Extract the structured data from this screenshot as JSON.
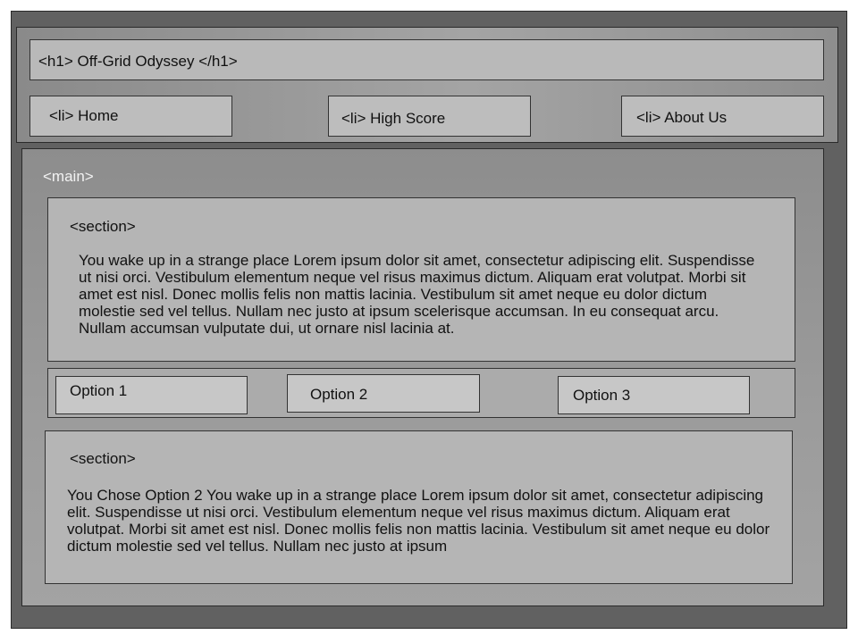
{
  "header": {
    "title": "<h1> Off-Grid Odyssey </h1>",
    "nav": [
      {
        "label": "<li> Home"
      },
      {
        "label": "<li> High Score"
      },
      {
        "label": "<li> About Us"
      }
    ]
  },
  "main": {
    "label": "<main>",
    "section1": {
      "label": "<section>",
      "text": "You wake up in a strange place Lorem ipsum dolor sit amet, consectetur adipiscing elit. Suspendisse ut nisi orci. Vestibulum elementum neque vel risus maximus dictum. Aliquam erat volutpat. Morbi sit amet est nisl. Donec mollis felis non mattis lacinia. Vestibulum sit amet neque eu dolor dictum molestie sed vel tellus. Nullam nec justo at ipsum scelerisque accumsan. In eu consequat arcu. Nullam accumsan vulputate dui, ut ornare nisl lacinia at."
    },
    "options": [
      {
        "label": "Option 1"
      },
      {
        "label": "Option 2"
      },
      {
        "label": "Option 3"
      }
    ],
    "section2": {
      "label": "<section>",
      "text": "You Chose Option 2 You wake up in a strange place Lorem ipsum dolor sit amet, consectetur adipiscing elit. Suspendisse ut nisi orci. Vestibulum elementum neque vel risus maximus dictum. Aliquam erat volutpat. Morbi sit amet est nisl. Donec mollis felis non mattis lacinia. Vestibulum sit amet neque eu dolor dictum molestie sed vel tellus. Nullam nec justo at ipsum"
    }
  }
}
